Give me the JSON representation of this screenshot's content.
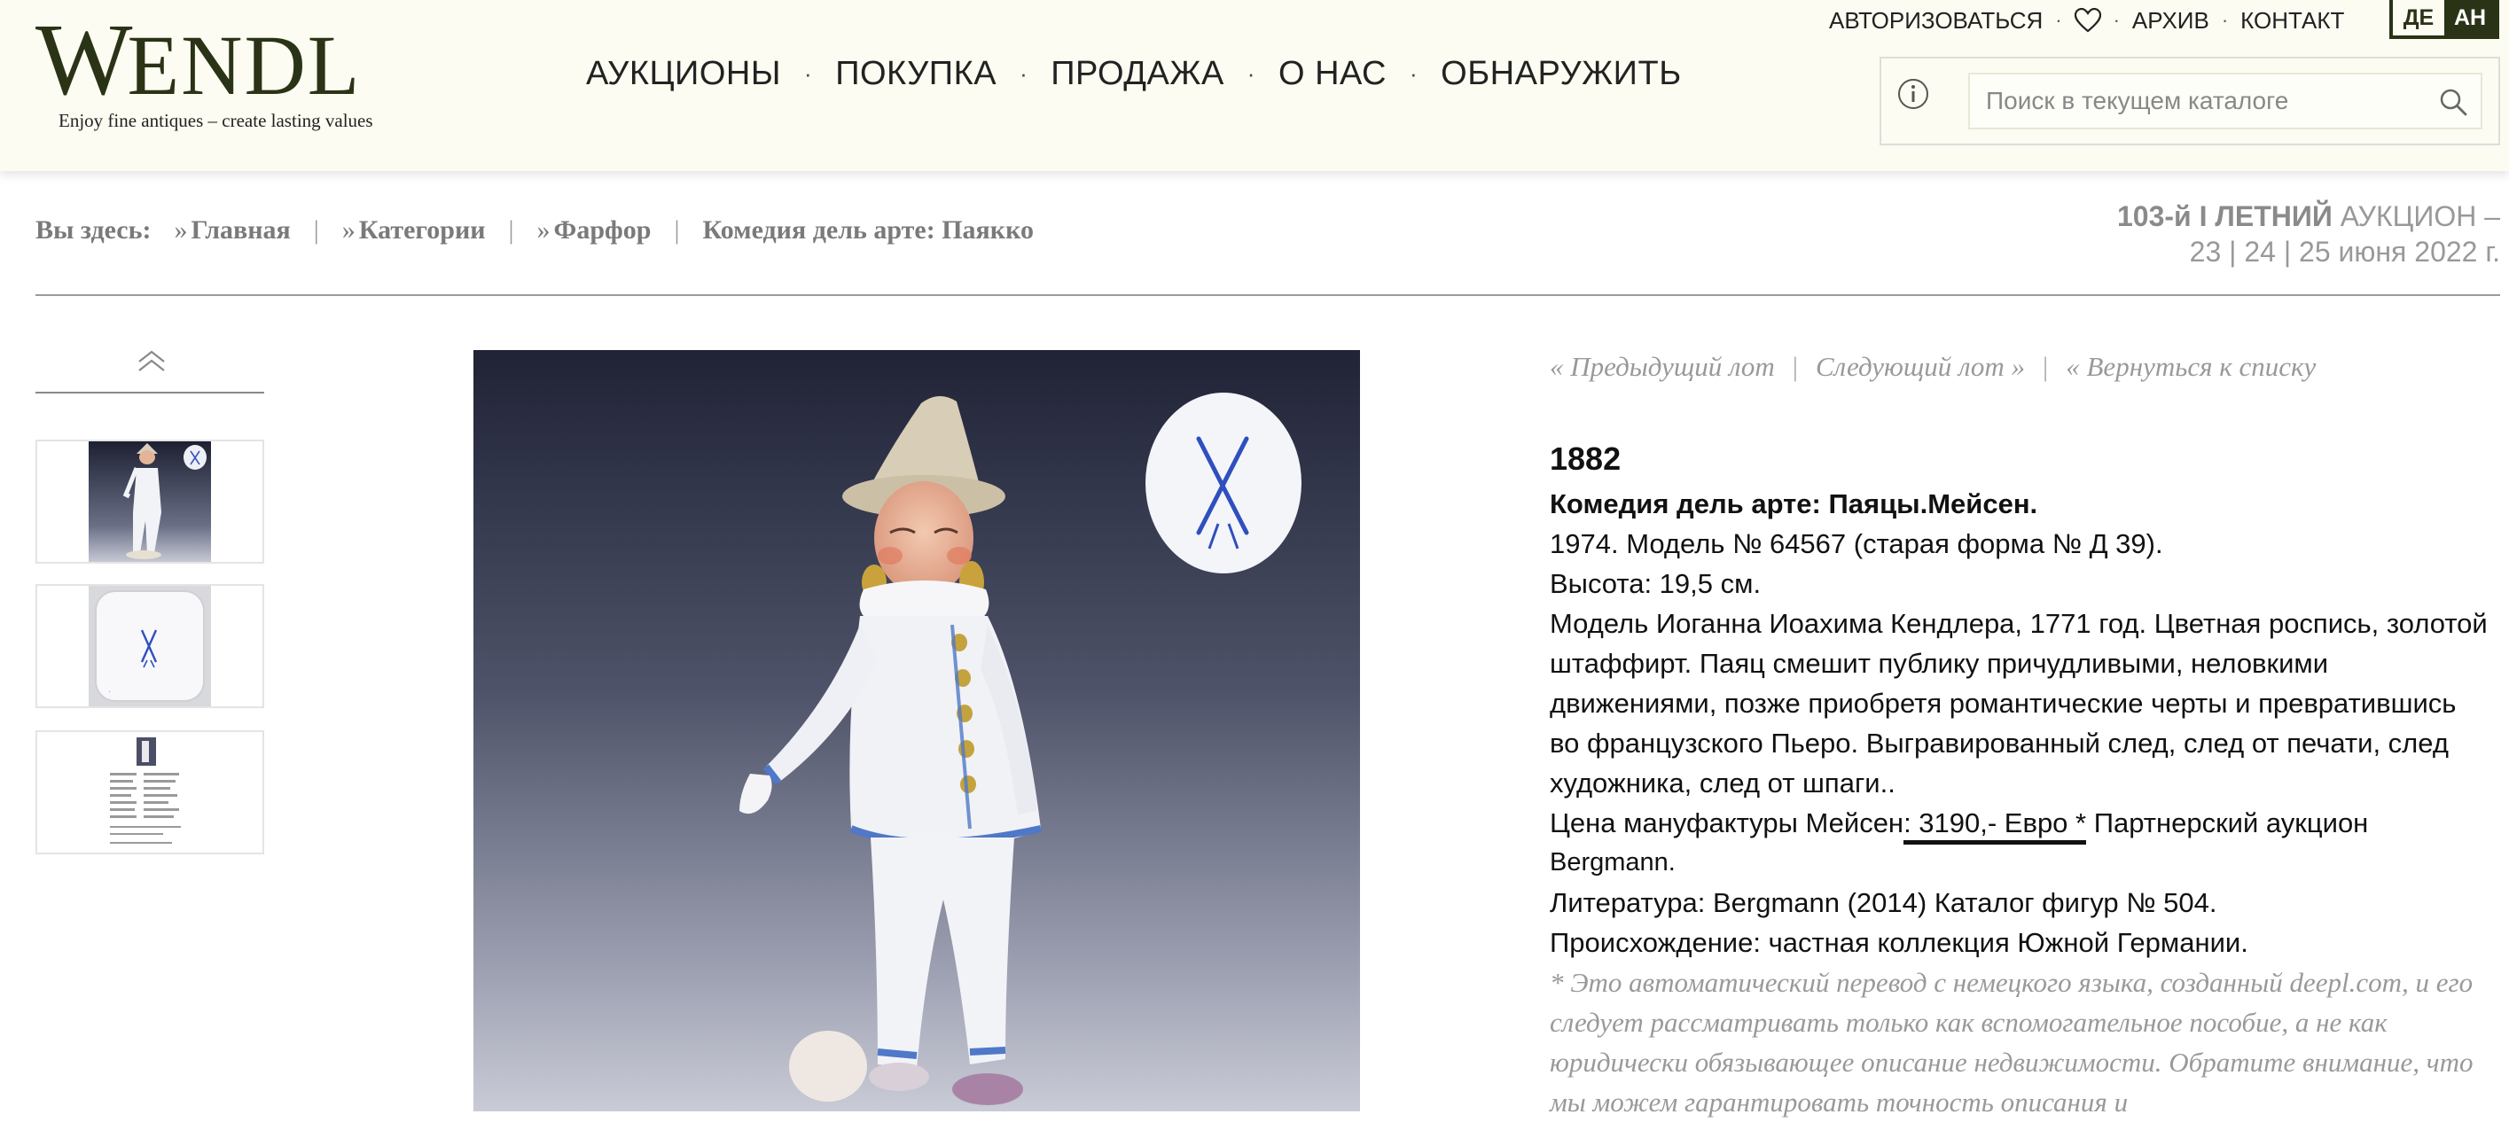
{
  "header": {
    "logo": "WENDL",
    "tagline": "Enjoy fine antiques – create lasting values",
    "nav": [
      "АУКЦИОНЫ",
      "ПОКУПКА",
      "ПРОДАЖА",
      "О НАС",
      "ОБНАРУЖИТЬ"
    ],
    "top_links": {
      "login": "АВТОРИЗОВАТЬСЯ",
      "favorites_icon": "heart-icon",
      "archive": "АРХИВ",
      "contact": "КОНТАКТ"
    },
    "languages": [
      "ДЕ",
      "АН"
    ],
    "search": {
      "placeholder": "Поиск в текущем каталоге",
      "info_icon": "info-icon",
      "search_icon": "search-icon"
    }
  },
  "breadcrumb": {
    "prefix": "Вы здесь:",
    "items": [
      "Главная",
      "Категории",
      "Фарфор"
    ],
    "current": "Комедия дель арте: Паякко"
  },
  "auction": {
    "line1_strong": "103-й I ЛЕТНИЙ",
    "line1_rest": "АУКЦИОН –",
    "line2": "23 | 24 | 25 июня 2022 г."
  },
  "lot_nav": {
    "prev": "« Предыдущий лот",
    "next": "Следующий лот »",
    "back": "« Вернуться к списку"
  },
  "lot": {
    "number": "1882",
    "title": "Комедия дель арте: Паяцы.Мейсен.",
    "model": "1974. Модель № 64567 (старая форма № Д 39).",
    "height": "Высота: 19,5 см.",
    "description": "Модель Иоганна Иоахима Кендлера, 1771 год. Цветная роспись, золотой штаффирт. Паяц смешит публику причудливыми, неловкими движениями, позже приобретя романтические черты и превратившись во французского Пьеро. Выгравированный след, след от печати, след художника, след от шпаги..",
    "price_prefix": "Цена мануфактуры Мейсен",
    "price_value": ": 3190,- Евро *",
    "price_suffix": " Партнерский аукцион",
    "price_partner": "Bergmann.",
    "literature": "Литература: Bergmann (2014) Каталог фигур № 504.",
    "provenance": "Происхождение: частная коллекция Южной Германии.",
    "disclaimer": "*  Это автоматический перевод с немецкого языка, созданный deepl.com, и его следует рассматривать только как вспомогательное пособие, а не как юридически обязывающее описание недвижимости. Обратите внимание, что мы можем гарантировать точность описания и"
  },
  "colors": {
    "brand": "#2a3316",
    "header_bg": "#fcfcf2",
    "muted": "#999999"
  }
}
